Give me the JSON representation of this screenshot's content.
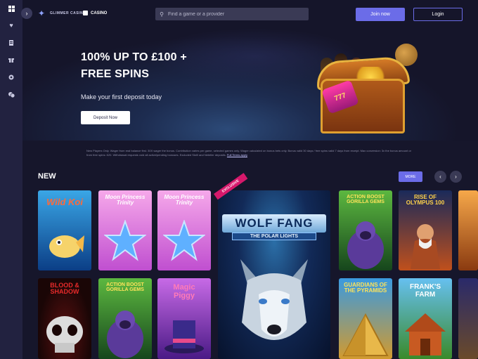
{
  "header": {
    "logo_text": "GLIMMER CASINO",
    "casino_label": "CASINO",
    "search_placeholder": "Find a game or a provider",
    "join_label": "Join now",
    "login_label": "Login"
  },
  "sidebar": {
    "items": [
      {
        "icon": "grid-icon"
      },
      {
        "icon": "heart-icon"
      },
      {
        "icon": "document-icon"
      },
      {
        "icon": "gift-icon"
      },
      {
        "icon": "settings-icon"
      },
      {
        "icon": "chat-icon"
      }
    ]
  },
  "hero": {
    "title_line1": "100% UP TO £100 +",
    "title_line2": "FREE SPINS",
    "subtitle": "Make your first deposit today",
    "cta_label": "Deposit Now",
    "slot_text": "777"
  },
  "terms": {
    "text": "New Players Only. Wager from real balance first. 30X wager the bonus. Contribution varies per game, selected games only. Wager calculated on bonus bets only. Bonus valid 30 days / free spins valid 7 days from receipt. Max conversion: 3x the bonus amount or from free spins: £20. Withdrawal requests void all active/pending bonuses. Excluded Skrill and Neteller deposits.",
    "link": "Full Terms apply"
  },
  "section": {
    "title": "NEW",
    "more_label": "MORE",
    "prev_icon": "‹",
    "next_icon": "›"
  },
  "games": [
    {
      "title": "Wild Koi",
      "colors": [
        "#2a9de0",
        "#0d4f9a"
      ]
    },
    {
      "title": "Moon Princess Trinity",
      "colors": [
        "#f28ee0",
        "#b545c5"
      ]
    },
    {
      "title": "Moon Princess Trinity",
      "colors": [
        "#f28ee0",
        "#b545c5"
      ]
    },
    {
      "title": "WOLF FANG",
      "subtitle": "THE POLAR LIGHTS",
      "badge": "EXCLUSIVE",
      "colors": [
        "#1d3d7a",
        "#0a1a3a"
      ]
    },
    {
      "title": "ACTION BOOST GORILLA GEMS",
      "colors": [
        "#4fa53a",
        "#1d5a26"
      ]
    },
    {
      "title": "RISE OF OLYMPUS 100",
      "colors": [
        "#c24a1c",
        "#3a1408"
      ]
    },
    {
      "title": "BLOOD & SHADOW",
      "colors": [
        "#3a0d0d",
        "#120606"
      ]
    },
    {
      "title": "ACTION BOOST GORILLA GEMS",
      "colors": [
        "#4fa53a",
        "#1d5a26"
      ]
    },
    {
      "title": "Magic Piggy",
      "colors": [
        "#c064e0",
        "#5a2090"
      ]
    },
    {
      "title": "GUARDIANS OF THE PYRAMIDS",
      "colors": [
        "#2e87d0",
        "#c88a2a"
      ]
    },
    {
      "title": "FRANK'S FARM",
      "colors": [
        "#54b4e8",
        "#3a8a2a"
      ]
    }
  ]
}
